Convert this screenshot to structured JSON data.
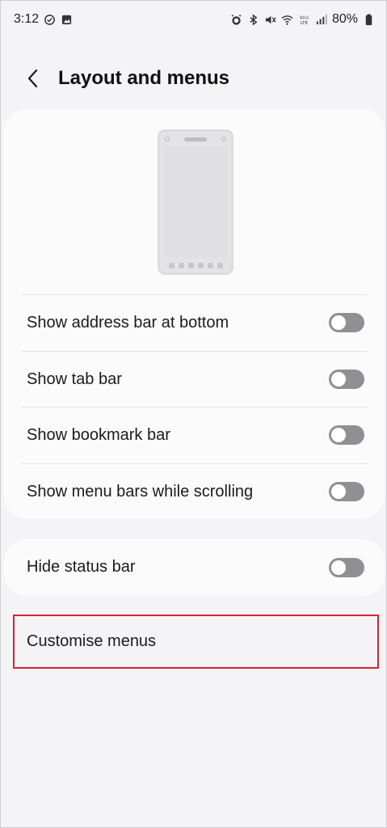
{
  "status_bar": {
    "time": "3:12",
    "left_icons": [
      "check-circle-icon",
      "gallery-icon"
    ],
    "right_icons": [
      "alarm-icon",
      "bluetooth-icon",
      "mute-icon",
      "wifi-icon",
      "volte-icon",
      "signal-icon"
    ],
    "battery": "80%"
  },
  "header": {
    "title": "Layout and menus"
  },
  "settings": {
    "show_address_bar_bottom": {
      "label": "Show address bar at bottom",
      "enabled": false
    },
    "show_tab_bar": {
      "label": "Show tab bar",
      "enabled": false
    },
    "show_bookmark_bar": {
      "label": "Show bookmark bar",
      "enabled": false
    },
    "show_menu_bars_scrolling": {
      "label": "Show menu bars while scrolling",
      "enabled": false
    },
    "hide_status_bar": {
      "label": "Hide status bar",
      "enabled": false
    }
  },
  "customise": {
    "label": "Customise menus",
    "highlight_color": "#d9202f"
  },
  "colors": {
    "toggle_off": "#8f8f94",
    "background": "#f4f4f6",
    "card": "#fbfbfc"
  }
}
